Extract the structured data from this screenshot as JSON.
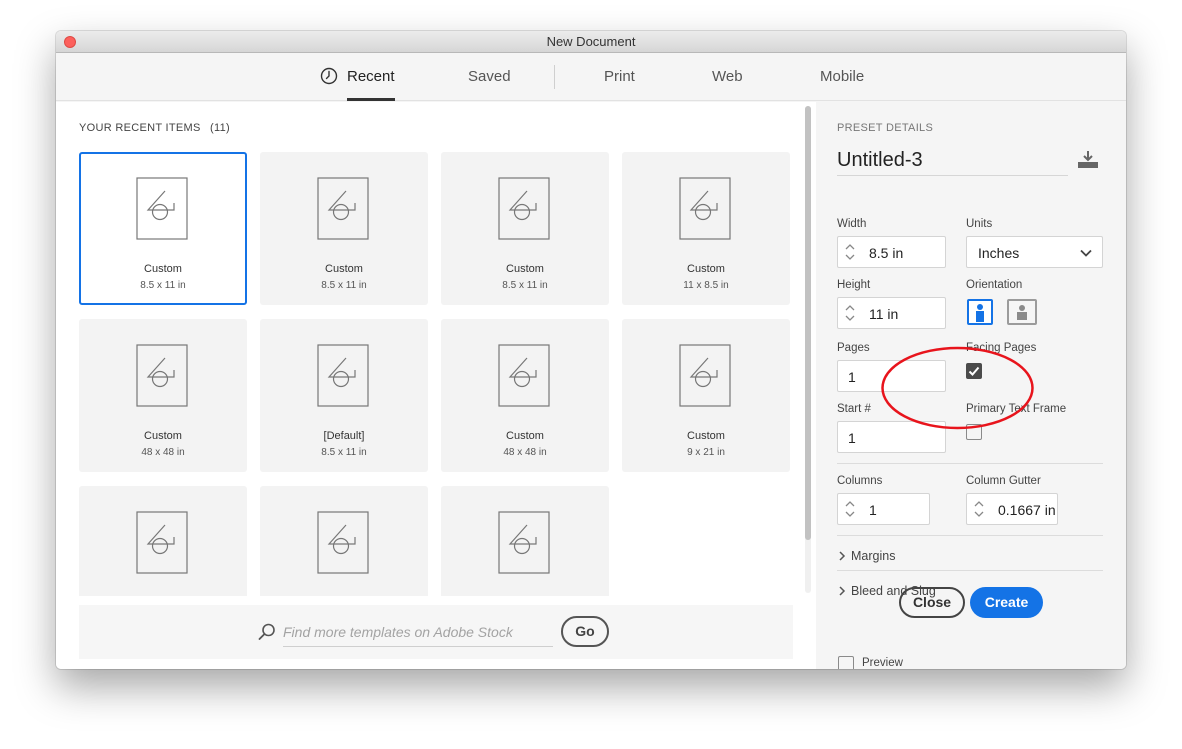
{
  "window": {
    "title": "New Document"
  },
  "tabs": [
    {
      "label": "Recent",
      "active": true,
      "icon": "clock-icon"
    },
    {
      "label": "Saved",
      "active": false
    },
    {
      "label": "Print",
      "active": false
    },
    {
      "label": "Web",
      "active": false
    },
    {
      "label": "Mobile",
      "active": false
    }
  ],
  "recent": {
    "heading": "YOUR RECENT ITEMS",
    "count": "(11)",
    "items": [
      {
        "name": "Custom",
        "size": "8.5 x 11 in",
        "selected": true
      },
      {
        "name": "Custom",
        "size": "8.5 x 11 in"
      },
      {
        "name": "Custom",
        "size": "8.5 x 11 in"
      },
      {
        "name": "Custom",
        "size": "11 x 8.5 in"
      },
      {
        "name": "Custom",
        "size": "48 x 48 in"
      },
      {
        "name": "[Default]",
        "size": "8.5 x 11 in"
      },
      {
        "name": "Custom",
        "size": "48 x 48 in"
      },
      {
        "name": "Custom",
        "size": "9 x 21 in"
      },
      {
        "name": "",
        "size": ""
      },
      {
        "name": "",
        "size": ""
      },
      {
        "name": "",
        "size": ""
      }
    ]
  },
  "stock": {
    "placeholder": "Find more templates on Adobe Stock",
    "go_label": "Go"
  },
  "preset": {
    "heading": "PRESET DETAILS",
    "name": "Untitled-3",
    "width_label": "Width",
    "width": "8.5 in",
    "units_label": "Units",
    "units": "Inches",
    "height_label": "Height",
    "height": "11 in",
    "orientation_label": "Orientation",
    "orientation": "portrait",
    "pages_label": "Pages",
    "pages": "1",
    "facing_pages_label": "Facing Pages",
    "facing_pages": true,
    "start_label": "Start #",
    "start": "1",
    "primary_text_frame_label": "Primary Text Frame",
    "primary_text_frame": false,
    "columns_label": "Columns",
    "columns": "1",
    "gutter_label": "Column Gutter",
    "gutter": "0.1667 in",
    "margins_label": "Margins",
    "bleed_label": "Bleed and Slug"
  },
  "footer": {
    "preview_label": "Preview",
    "preview_checked": false,
    "close_label": "Close",
    "create_label": "Create"
  },
  "colors": {
    "accent": "#1473e6",
    "annotation": "#e8141c"
  }
}
